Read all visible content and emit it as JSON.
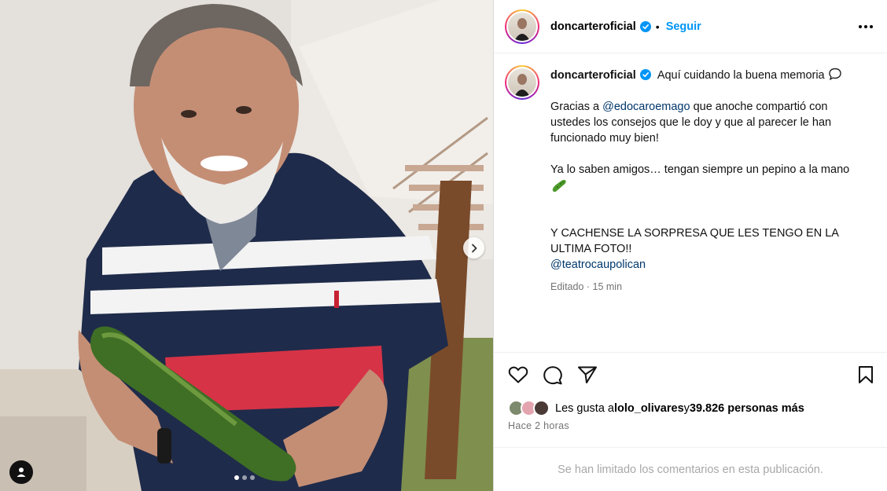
{
  "post": {
    "username": "doncarteroficial",
    "follow_label": "Seguir",
    "separator": "•",
    "verified_icon": "verified-badge-icon",
    "carousel": {
      "current": 1,
      "total": 3
    }
  },
  "caption": {
    "first_line": "Aquí cuidando la buena memoria",
    "para2_prefix": "Gracias a ",
    "para2_mention": "@edocaroemago",
    "para2_rest": " que anoche compartió con ustedes los consejos que le doy y que al parecer le han funcionado muy bien!",
    "para3": "Ya lo saben amigos… tengan siempre un pepino a la mano",
    "para4": "Y CACHENSE LA SORPRESA QUE LES TENGO EN LA ULTIMA FOTO!!",
    "mention2": "@teatrocaupolican",
    "edited": "Editado",
    "edited_sep": " · ",
    "edited_time": "15 min"
  },
  "likes": {
    "prefix": "Les gusta a ",
    "user": "lolo_olivares",
    "middle": " y ",
    "count": "39.826 personas más"
  },
  "time_ago": "Hace 2 horas",
  "comments_limited": "Se han limitado los comentarios en esta publicación.",
  "colors": {
    "link_blue": "#0095f6",
    "mention": "#00376b",
    "muted": "#737373",
    "verified": "#0095f6"
  },
  "icons": [
    "heart-icon",
    "comment-icon",
    "share-icon",
    "bookmark-icon",
    "more-options-icon",
    "chevron-right-icon",
    "user-tag-icon",
    "speech-bubble-icon",
    "cucumber-emoji-icon"
  ]
}
